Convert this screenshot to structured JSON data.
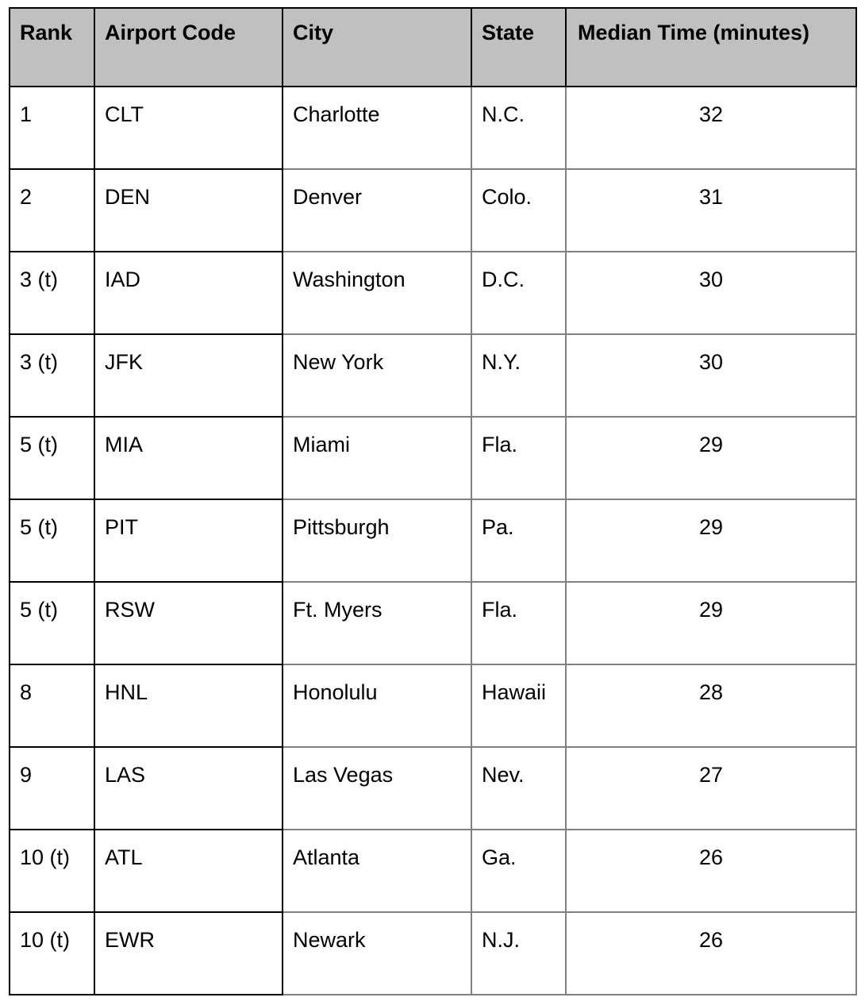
{
  "table": {
    "columns": [
      {
        "key": "rank",
        "label": "Rank"
      },
      {
        "key": "code",
        "label": "Airport Code"
      },
      {
        "key": "city",
        "label": "City"
      },
      {
        "key": "state",
        "label": "State"
      },
      {
        "key": "median",
        "label": "Median Time (minutes)"
      }
    ],
    "rows": [
      {
        "rank": "1",
        "code": "CLT",
        "city": "Charlotte",
        "state": "N.C.",
        "median": "32"
      },
      {
        "rank": "2",
        "code": "DEN",
        "city": "Denver",
        "state": "Colo.",
        "median": "31"
      },
      {
        "rank": "3 (t)",
        "code": "IAD",
        "city": "Washington",
        "state": "D.C.",
        "median": "30"
      },
      {
        "rank": "3 (t)",
        "code": "JFK",
        "city": "New York",
        "state": "N.Y.",
        "median": "30"
      },
      {
        "rank": "5 (t)",
        "code": "MIA",
        "city": "Miami",
        "state": "Fla.",
        "median": "29"
      },
      {
        "rank": "5 (t)",
        "code": "PIT",
        "city": "Pittsburgh",
        "state": "Pa.",
        "median": "29"
      },
      {
        "rank": "5 (t)",
        "code": "RSW",
        "city": "Ft. Myers",
        "state": "Fla.",
        "median": "29"
      },
      {
        "rank": "8",
        "code": "HNL",
        "city": "Honolulu",
        "state": "Hawaii",
        "median": "28"
      },
      {
        "rank": "9",
        "code": "LAS",
        "city": "Las Vegas",
        "state": "Nev.",
        "median": "27"
      },
      {
        "rank": "10 (t)",
        "code": "ATL",
        "city": "Atlanta",
        "state": "Ga.",
        "median": "26"
      },
      {
        "rank": "10 (t)",
        "code": "EWR",
        "city": "Newark",
        "state": "N.J.",
        "median": "26"
      }
    ]
  },
  "colors": {
    "header_background": "#c0c0c0",
    "body_background": "#ffffff",
    "text": "#000000",
    "border_strong": "#000000",
    "border_light": "#808080"
  },
  "chart_data": {
    "type": "table",
    "title": "",
    "columns": [
      "Rank",
      "Airport Code",
      "City",
      "State",
      "Median Time (minutes)"
    ],
    "rows": [
      [
        "1",
        "CLT",
        "Charlotte",
        "N.C.",
        32
      ],
      [
        "2",
        "DEN",
        "Denver",
        "Colo.",
        31
      ],
      [
        "3 (t)",
        "IAD",
        "Washington",
        "D.C.",
        30
      ],
      [
        "3 (t)",
        "JFK",
        "New York",
        "N.Y.",
        30
      ],
      [
        "5 (t)",
        "MIA",
        "Miami",
        "Fla.",
        29
      ],
      [
        "5 (t)",
        "PIT",
        "Pittsburgh",
        "Pa.",
        29
      ],
      [
        "5 (t)",
        "RSW",
        "Ft. Myers",
        "Fla.",
        29
      ],
      [
        "8",
        "HNL",
        "Honolulu",
        "Hawaii",
        28
      ],
      [
        "9",
        "LAS",
        "Las Vegas",
        "Nev.",
        27
      ],
      [
        "10 (t)",
        "ATL",
        "Atlanta",
        "Ga.",
        26
      ],
      [
        "10 (t)",
        "EWR",
        "Newark",
        "N.J.",
        26
      ]
    ]
  }
}
